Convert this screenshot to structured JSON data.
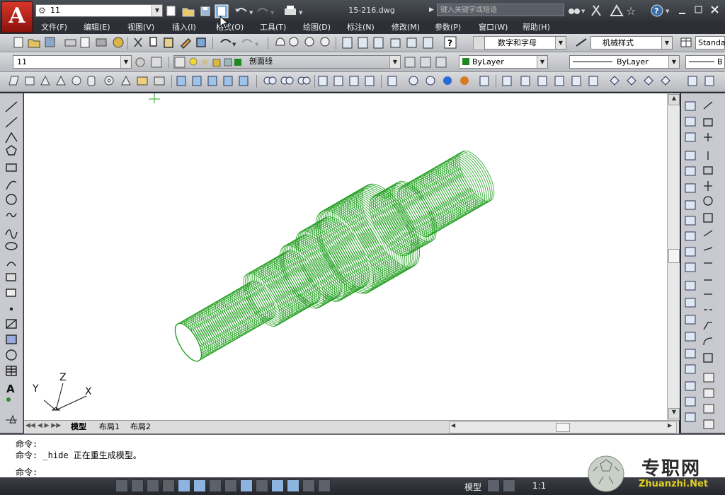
{
  "titlebar": {
    "workspace": "11",
    "filename": "15-216.dwg",
    "search_placeholder": "键入关键字或短语"
  },
  "menu": [
    "文件(F)",
    "编辑(E)",
    "视图(V)",
    "插入(I)",
    "格式(O)",
    "工具(T)",
    "绘图(D)",
    "标注(N)",
    "修改(M)",
    "参数(P)",
    "窗口(W)",
    "帮助(H)"
  ],
  "toolbar2": {
    "text_style": "数字和字母",
    "dim_style": "机械样式",
    "table_style": "Standa"
  },
  "toolbar3": {
    "workspace": "11",
    "layer": "剖面线",
    "color": "ByLayer",
    "linetype": "ByLayer",
    "lineweight": "B"
  },
  "ucs": {
    "x": "X",
    "y": "Y",
    "z": "Z"
  },
  "tabs": [
    "模型",
    "布局1",
    "布局2"
  ],
  "command": {
    "line1": "命令:",
    "line2": "命令: _hide 正在重生成模型。",
    "line3": "命令:"
  },
  "status": {
    "model": "模型",
    "scale": "1:1"
  },
  "watermark": {
    "title": "专职网",
    "url": "Zhuanzhi.Net"
  },
  "colors": {
    "shaft": "#22a020",
    "layer_swatch": "#1e8a1e"
  }
}
